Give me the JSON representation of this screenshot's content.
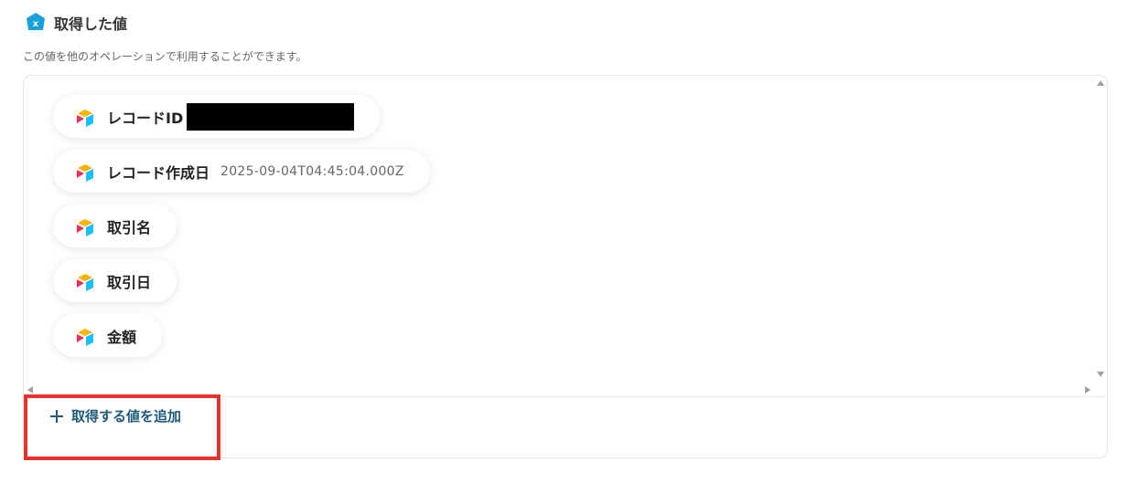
{
  "section": {
    "title": "取得した値",
    "description": "この値を他のオペレーションで利用することができます。"
  },
  "fields": [
    {
      "label": "レコードID",
      "value": "",
      "redacted": true,
      "icon": "airtable-icon"
    },
    {
      "label": "レコード作成日",
      "value": "2025-09-04T04:45:04.000Z",
      "icon": "airtable-icon"
    },
    {
      "label": "取引名",
      "value": "",
      "icon": "airtable-icon"
    },
    {
      "label": "取引日",
      "value": "",
      "icon": "airtable-icon"
    },
    {
      "label": "金額",
      "value": "",
      "icon": "airtable-icon"
    }
  ],
  "actions": {
    "add_label": "取得する値を追加",
    "add_icon": "plus-icon"
  },
  "colors": {
    "badge": "#1aa0d8",
    "add_text": "#1e5a7a",
    "highlight": "#e8332a"
  }
}
